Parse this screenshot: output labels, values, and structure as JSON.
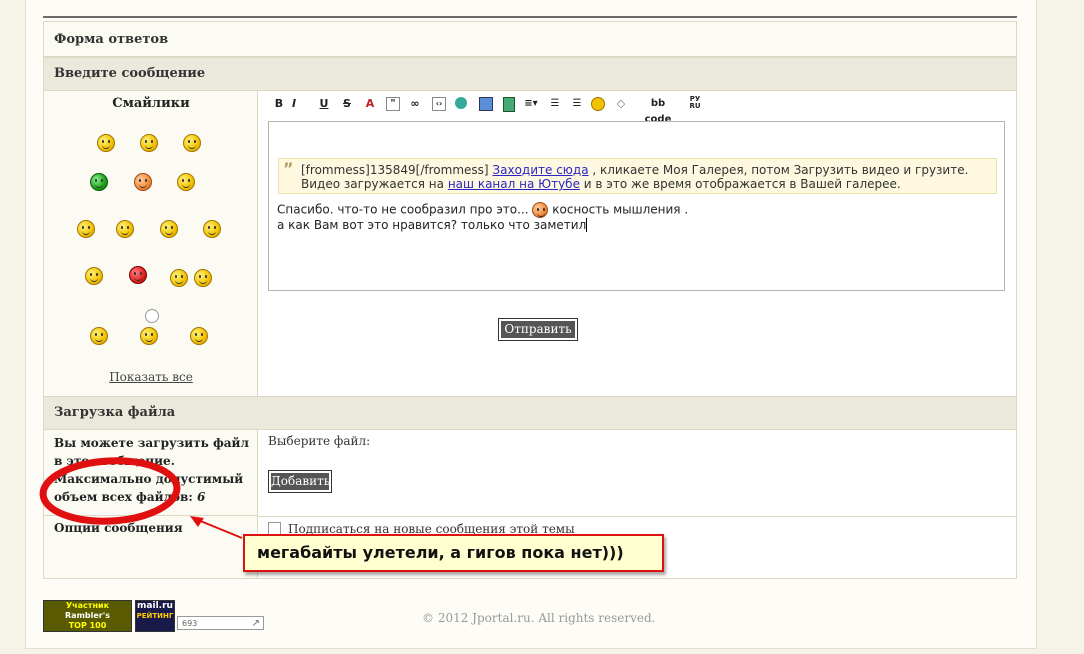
{
  "form": {
    "title": "Форма ответов",
    "message_header": "Введите сообщение",
    "smilies_title": "Смайлики",
    "show_all": "Показать все",
    "toolbar": {
      "bold": "B",
      "italic": "I",
      "underline": "U",
      "strike": "S",
      "bbcode": "bb code",
      "translit": "РУ RU"
    },
    "editor": {
      "quote_author": "[frommess]135849[/frommess]",
      "quote_link1": "Заходите сюда",
      "quote_text1": ", кликаете Моя Галерея, потом Загрузить видео и грузите.",
      "quote_text2": "Видео загружается на",
      "quote_link2": "наш канал на Ютубе",
      "quote_text3": "и в это же время отображается в Вашей галерее.",
      "line1_a": "Спасибо. что-то не сообразил про это...",
      "line1_b": "косность мышления .",
      "line2": "а как Вам вот это нравится? только что заметил"
    },
    "submit_label": "Отправить »",
    "upload_header": "Загрузка файла",
    "upload_desc": "Вы можете загрузить файл в это сообщение. Максимально допустимый объем всех файлов:",
    "upload_limit": "6",
    "choose_file": "Выберите файл:",
    "add_label": "Добавить",
    "options_label": "Опции сообщения",
    "subscribe_label": "Подписаться на новые сообщения этой темы"
  },
  "annotation": {
    "text": "мегабайты улетели, а гигов пока нет)))",
    "color": "#dd1111"
  },
  "footer": {
    "copyright": "© 2012 Jportal.ru. All rights reserved.",
    "rambler": [
      "Участник",
      "Rambler's",
      "TOP 100"
    ],
    "mailru": [
      "mail.ru",
      "РЕЙТИНГ"
    ],
    "counter": "693"
  }
}
